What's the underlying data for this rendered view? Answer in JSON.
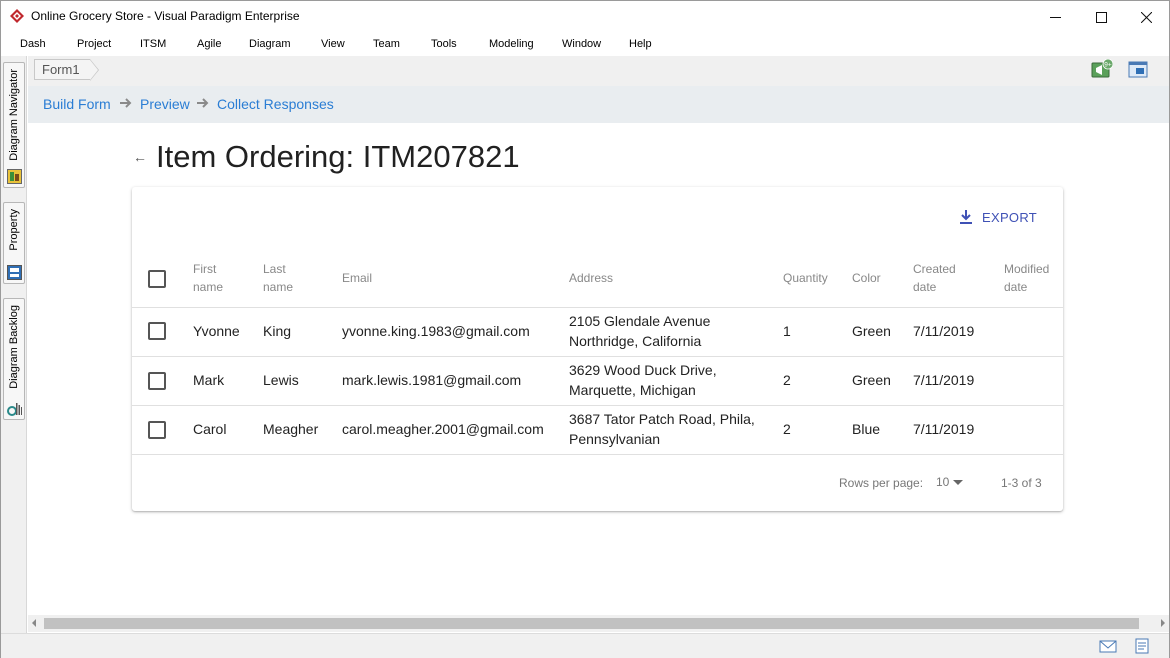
{
  "window": {
    "title": "Online Grocery Store - Visual Paradigm Enterprise"
  },
  "menu": {
    "items": [
      "Dash",
      "Project",
      "ITSM",
      "Agile",
      "Diagram",
      "View",
      "Team",
      "Tools",
      "Modeling",
      "Window",
      "Help"
    ]
  },
  "side_tabs": [
    "Diagram Navigator",
    "Property",
    "Diagram Backlog"
  ],
  "editor": {
    "breadcrumb": "Form1",
    "notification_badge": "9+"
  },
  "steps": [
    "Build Form",
    "Preview",
    "Collect Responses"
  ],
  "page": {
    "title": "Item Ordering: ITM207821"
  },
  "table": {
    "export_label": "EXPORT",
    "headers": {
      "first_name": [
        "First",
        "name"
      ],
      "last_name": [
        "Last",
        "name"
      ],
      "email": "Email",
      "address": "Address",
      "quantity": "Quantity",
      "color": "Color",
      "created": [
        "Created",
        "date"
      ],
      "modified": [
        "Modified",
        "date"
      ]
    },
    "rows": [
      {
        "first": "Yvonne",
        "last": "King",
        "email": "yvonne.king.1983@gmail.com",
        "address1": "2105 Glendale Avenue",
        "address2": "Northridge, California",
        "quantity": "1",
        "color": "Green",
        "created": "7/11/2019",
        "modified": ""
      },
      {
        "first": "Mark",
        "last": "Lewis",
        "email": "mark.lewis.1981@gmail.com",
        "address1": "3629 Wood Duck Drive,",
        "address2": "Marquette, Michigan",
        "quantity": "2",
        "color": "Green",
        "created": "7/11/2019",
        "modified": ""
      },
      {
        "first": "Carol",
        "last": "Meagher",
        "email": "carol.meagher.2001@gmail.com",
        "address1": "3687 Tator Patch Road, Phila,",
        "address2": "Pennsylvanian",
        "quantity": "2",
        "color": "Blue",
        "created": "7/11/2019",
        "modified": ""
      }
    ],
    "footer": {
      "rows_per_page_label": "Rows per page:",
      "rows_per_page_value": "10",
      "range": "1-3 of 3"
    }
  },
  "colors": {
    "link_blue": "#2a7dd4",
    "export_indigo": "#3f51b5",
    "brand_red": "#c0282d"
  }
}
